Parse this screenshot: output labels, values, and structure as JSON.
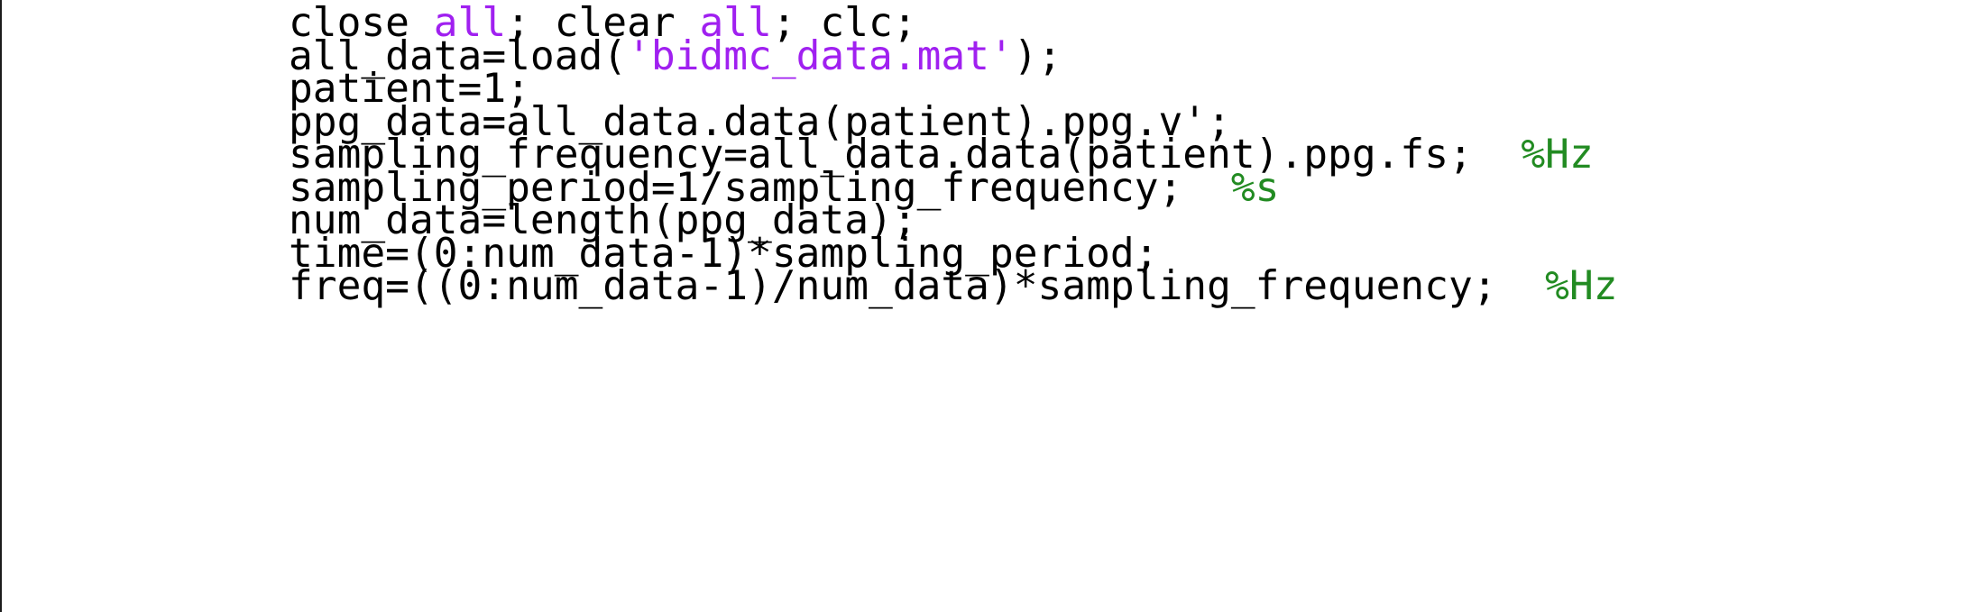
{
  "editor": {
    "language": "MATLAB",
    "background_color": "#ffffff",
    "left_border_color": "#1c1c1c",
    "colors": {
      "plain": "#000000",
      "keyword": "#a020f0",
      "string": "#a020f0",
      "comment": "#228b22"
    },
    "lines": [
      {
        "index": 1,
        "text": "close all; clear all; clc;",
        "tokens": [
          {
            "kind": "plain",
            "text": "close "
          },
          {
            "kind": "keyword",
            "text": "all"
          },
          {
            "kind": "plain",
            "text": "; clear "
          },
          {
            "kind": "keyword",
            "text": "all"
          },
          {
            "kind": "plain",
            "text": "; clc;"
          }
        ]
      },
      {
        "index": 2,
        "text": "all_data=load('bidmc_data.mat');",
        "tokens": [
          {
            "kind": "plain",
            "text": "all_data=load("
          },
          {
            "kind": "string",
            "text": "'bidmc_data.mat'"
          },
          {
            "kind": "plain",
            "text": ");"
          }
        ]
      },
      {
        "index": 3,
        "text": "patient=1;",
        "tokens": [
          {
            "kind": "plain",
            "text": "patient=1;"
          }
        ]
      },
      {
        "index": 4,
        "text": "ppg_data=all_data.data(patient).ppg.v';",
        "tokens": [
          {
            "kind": "plain",
            "text": "ppg_data=all_data.data(patient).ppg.v';"
          }
        ]
      },
      {
        "index": 5,
        "text": "sampling_frequency=all_data.data(patient).ppg.fs;  %Hz",
        "tokens": [
          {
            "kind": "plain",
            "text": "sampling_frequency=all_data.data(patient).ppg.fs;  "
          },
          {
            "kind": "comment",
            "text": "%Hz"
          }
        ]
      },
      {
        "index": 6,
        "text": "sampling_period=1/sampling_frequency;  %s",
        "tokens": [
          {
            "kind": "plain",
            "text": "sampling_period=1/sampling_frequency;  "
          },
          {
            "kind": "comment",
            "text": "%s"
          }
        ]
      },
      {
        "index": 7,
        "text": "num_data=length(ppg_data);",
        "tokens": [
          {
            "kind": "plain",
            "text": "num_data=length(ppg_data);"
          }
        ]
      },
      {
        "index": 8,
        "text": "time=(0:num_data-1)*sampling_period;",
        "tokens": [
          {
            "kind": "plain",
            "text": "time=(0:num_data-1)*sampling_period;"
          }
        ]
      },
      {
        "index": 9,
        "text": "freq=((0:num_data-1)/num_data)*sampling_frequency;  %Hz",
        "tokens": [
          {
            "kind": "plain",
            "text": "freq=((0:num_data-1)/num_data)*sampling_frequency;  "
          },
          {
            "kind": "comment",
            "text": "%Hz"
          }
        ]
      }
    ]
  }
}
